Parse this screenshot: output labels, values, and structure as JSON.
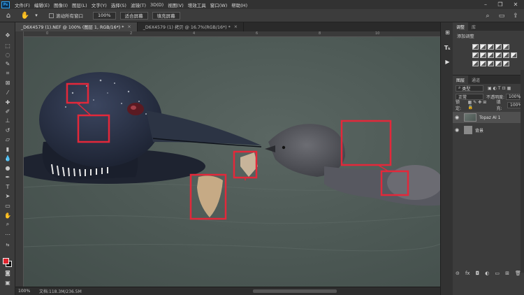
{
  "app": {
    "logo": "Ps"
  },
  "menu": [
    "文件(F)",
    "编辑(E)",
    "图像(I)",
    "图层(L)",
    "文字(Y)",
    "选择(S)",
    "滤镜(T)",
    "3D(D)",
    "视图(V)",
    "增效工具",
    "窗口(W)",
    "帮助(H)"
  ],
  "options": {
    "scroll_all_label": "滚动所有窗口",
    "zoom_value": "100%",
    "fit_screen": "适合屏幕",
    "fill_screen": "填充屏幕"
  },
  "tabs": [
    {
      "label": "_D6X4579 (1).NEF @ 100% (图层 1, RGB/16*) *",
      "active": true
    },
    {
      "label": "_D6X4579 (1) 拷贝 @ 16.7%(RGB/16*) *",
      "active": false
    }
  ],
  "ruler_ticks": [
    "0",
    "2",
    "4",
    "6",
    "8",
    "10"
  ],
  "status": {
    "zoom": "100%",
    "doc": "文档:118.3M/236.5M"
  },
  "adjust_panel": {
    "tabs": [
      "调整",
      "库"
    ],
    "title": "添加调整"
  },
  "layers_panel": {
    "tabs": [
      "图层",
      "通道"
    ],
    "kind_filter": "类型",
    "blend_mode": "正常",
    "opacity_label": "不透明度:",
    "opacity_value": "100%",
    "lock_label": "锁定:",
    "fill_label": "填充:",
    "fill_value": "100%",
    "layers": [
      {
        "name": "Topaz AI 1",
        "active": true
      },
      {
        "name": "背景",
        "active": false
      }
    ]
  },
  "colors": {
    "foreground": "#e0242e",
    "background": "#111111",
    "highlight_box": "#e3283a"
  }
}
